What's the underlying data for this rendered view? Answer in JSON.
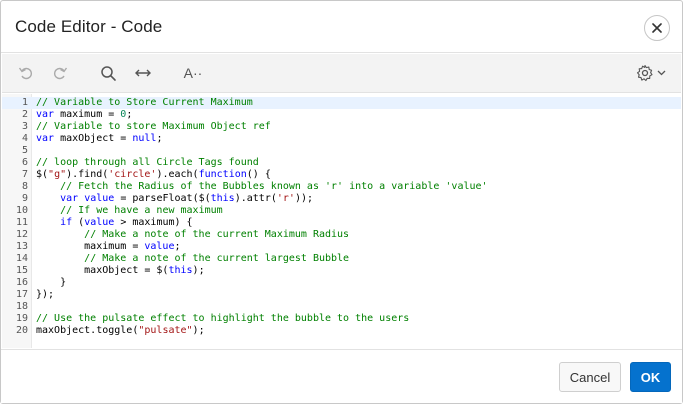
{
  "dialog": {
    "title": "Code Editor - Code",
    "close_icon": "close-icon"
  },
  "toolbar": {
    "undo_icon": "undo-icon",
    "redo_icon": "redo-icon",
    "search_icon": "search-icon",
    "wrap_icon": "horizontal-arrows-icon",
    "font_icon": "text-size-icon",
    "font_label": "A··",
    "settings_icon": "gear-icon",
    "settings_dropdown_icon": "chevron-down-icon"
  },
  "editor": {
    "active_line": 1,
    "line_numbers": [
      "1",
      "2",
      "3",
      "4",
      "5",
      "6",
      "7",
      "8",
      "9",
      "10",
      "11",
      "12",
      "13",
      "14",
      "15",
      "16",
      "17",
      "18",
      "19",
      "20"
    ],
    "lines": [
      [
        {
          "t": "// Variable to Store Current Maximum",
          "c": "comment"
        }
      ],
      [
        {
          "t": "var",
          "c": "kw"
        },
        {
          "t": " maximum = ",
          "c": "plain"
        },
        {
          "t": "0",
          "c": "num"
        },
        {
          "t": ";",
          "c": "plain"
        }
      ],
      [
        {
          "t": "// Variable to store Maximum Object ref",
          "c": "comment"
        }
      ],
      [
        {
          "t": "var",
          "c": "kw"
        },
        {
          "t": " maxObject = ",
          "c": "plain"
        },
        {
          "t": "null",
          "c": "kw"
        },
        {
          "t": ";",
          "c": "plain"
        }
      ],
      [
        {
          "t": "",
          "c": "plain"
        }
      ],
      [
        {
          "t": "// loop through all Circle Tags found",
          "c": "comment"
        }
      ],
      [
        {
          "t": "$(",
          "c": "plain"
        },
        {
          "t": "\"g\"",
          "c": "str"
        },
        {
          "t": ").find(",
          "c": "plain"
        },
        {
          "t": "'circle'",
          "c": "str"
        },
        {
          "t": ").each(",
          "c": "plain"
        },
        {
          "t": "function",
          "c": "kw"
        },
        {
          "t": "() {",
          "c": "plain"
        }
      ],
      [
        {
          "t": "    ",
          "c": "plain"
        },
        {
          "t": "// Fetch the Radius of the Bubbles known as 'r' into a variable 'value'",
          "c": "comment"
        }
      ],
      [
        {
          "t": "    ",
          "c": "plain"
        },
        {
          "t": "var",
          "c": "kw"
        },
        {
          "t": " ",
          "c": "plain"
        },
        {
          "t": "value",
          "c": "kw"
        },
        {
          "t": " = parseFloat($(",
          "c": "plain"
        },
        {
          "t": "this",
          "c": "kw"
        },
        {
          "t": ").attr(",
          "c": "plain"
        },
        {
          "t": "'r'",
          "c": "str"
        },
        {
          "t": "));",
          "c": "plain"
        }
      ],
      [
        {
          "t": "    ",
          "c": "plain"
        },
        {
          "t": "// If we have a new maximum",
          "c": "comment"
        }
      ],
      [
        {
          "t": "    ",
          "c": "plain"
        },
        {
          "t": "if",
          "c": "kw"
        },
        {
          "t": " (",
          "c": "plain"
        },
        {
          "t": "value",
          "c": "kw"
        },
        {
          "t": " > maximum) {",
          "c": "plain"
        }
      ],
      [
        {
          "t": "        ",
          "c": "plain"
        },
        {
          "t": "// Make a note of the current Maximum Radius",
          "c": "comment"
        }
      ],
      [
        {
          "t": "        maximum = ",
          "c": "plain"
        },
        {
          "t": "value",
          "c": "kw"
        },
        {
          "t": ";",
          "c": "plain"
        }
      ],
      [
        {
          "t": "        ",
          "c": "plain"
        },
        {
          "t": "// Make a note of the current largest Bubble",
          "c": "comment"
        }
      ],
      [
        {
          "t": "        maxObject = $(",
          "c": "plain"
        },
        {
          "t": "this",
          "c": "kw"
        },
        {
          "t": ");",
          "c": "plain"
        }
      ],
      [
        {
          "t": "    }",
          "c": "plain"
        }
      ],
      [
        {
          "t": "});",
          "c": "plain"
        }
      ],
      [
        {
          "t": "",
          "c": "plain"
        }
      ],
      [
        {
          "t": "// Use the pulsate effect to highlight the bubble to the users",
          "c": "comment"
        }
      ],
      [
        {
          "t": "maxObject.toggle(",
          "c": "plain"
        },
        {
          "t": "\"pulsate\"",
          "c": "str"
        },
        {
          "t": ");",
          "c": "plain"
        }
      ]
    ]
  },
  "footer": {
    "cancel_label": "Cancel",
    "ok_label": "OK"
  },
  "colors": {
    "accent": "#0572ce",
    "comment": "#008000",
    "keyword": "#0000ff",
    "string": "#a31515",
    "number": "#098658"
  }
}
